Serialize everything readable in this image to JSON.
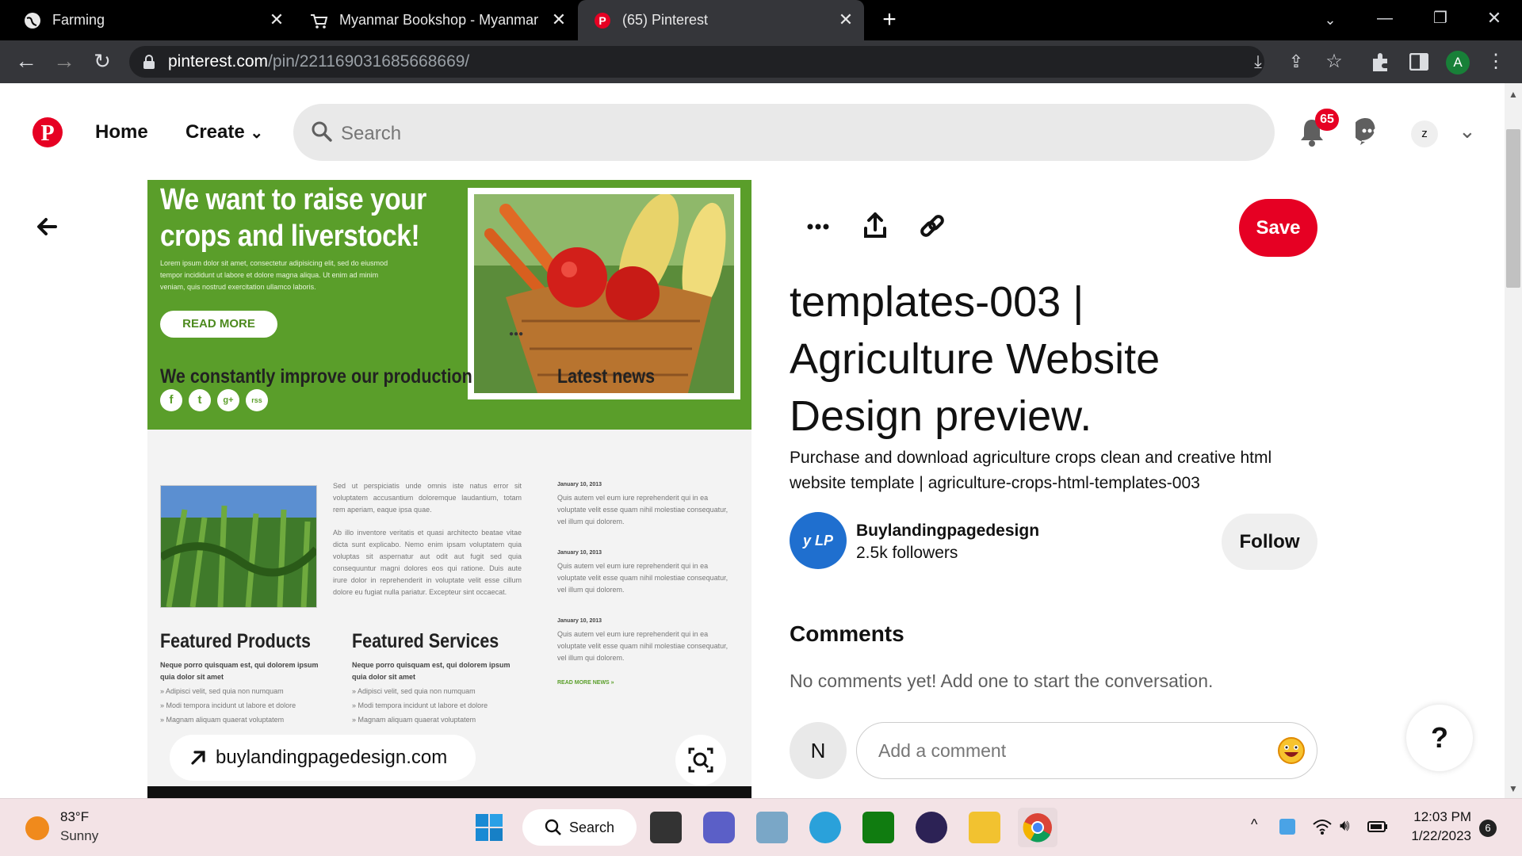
{
  "browser": {
    "tabs": [
      {
        "title": "Farming",
        "icon": "globe-icon"
      },
      {
        "title": "Myanmar Bookshop - Myanmar",
        "icon": "cart-icon"
      },
      {
        "title": "(65) Pinterest",
        "icon": "pinterest-icon"
      }
    ],
    "url_domain": "pinterest.com",
    "url_path": "/pin/221169031685668669/",
    "profile_initial": "A"
  },
  "header": {
    "nav_home": "Home",
    "nav_create": "Create",
    "search_placeholder": "Search",
    "notification_count": "65",
    "user_initial": "z"
  },
  "pin_image": {
    "hero_line1": "We want to raise your",
    "hero_line2": "crops and liverstock!",
    "hero_lorem_1": "Lorem ipsum dolor sit amet, consectetur adipisicing elit, sed do eiusmod",
    "hero_lorem_2": "tempor incididunt ut labore et dolore magna aliqua. Ut enim ad minim",
    "hero_lorem_3": "veniam, quis nostrud exercitation ullamco laboris.",
    "read_more": "READ MORE",
    "social": [
      "f",
      "t",
      "g+",
      "rss"
    ],
    "section1_title": "We constantly improve our production",
    "section1_p1": "Sed ut perspiciatis unde omnis iste natus error sit voluptatem accusantium doloremque laudantium, totam rem aperiam, eaque ipsa quae.",
    "section1_p2": "Ab illo inventore veritatis et quasi architecto beatae vitae dicta sunt explicabo. Nemo enim ipsam voluptatem quia voluptas sit aspernatur aut odit aut fugit sed quia consequuntur magni dolores eos qui ratione. Duis aute irure dolor in reprehenderit in voluptate velit esse cillum dolore eu fugiat nulla pariatur. Excepteur sint occaecat.",
    "news_title": "Latest news",
    "news_items": [
      {
        "date": "January 10, 2013",
        "text": "Quis autem vel eum iure reprehenderit qui in ea voluptate velit esse quam nihil molestiae consequatur, vel illum qui dolorem."
      },
      {
        "date": "January 10, 2013",
        "text": "Quis autem vel eum iure reprehenderit qui in ea voluptate velit esse quam nihil molestiae consequatur, vel illum qui dolorem."
      },
      {
        "date": "January 10, 2013",
        "text": "Quis autem vel eum iure reprehenderit qui in ea voluptate velit esse quam nihil molestiae consequatur, vel illum qui dolorem."
      }
    ],
    "read_more_news": "READ MORE NEWS »",
    "products_title": "Featured Products",
    "services_title": "Featured Services",
    "feature_bold": "Neque porro quisquam est, qui dolorem ipsum quia dolor sit amet",
    "feature_list": [
      "» Adipisci velit, sed quia non numquam",
      "» Modi tempora incidunt ut labore et dolore",
      "» Magnam aliquam quaerat voluptatem"
    ],
    "link_text": "buylandingpagedesign.com"
  },
  "pin": {
    "save_label": "Save",
    "title": "templates-003 | Agriculture Website Design preview.",
    "description": "Purchase and download agriculture crops clean and creative html website template | agriculture-crops-html-templates-003",
    "creator_avatar_text": "y LP Des",
    "creator_name": "Buylandingpagedesign",
    "followers": "2.5k followers",
    "follow_label": "Follow",
    "comments_heading": "Comments",
    "no_comments": "No comments yet! Add one to start the conversation.",
    "commenter_initial": "N",
    "comment_placeholder": "Add a comment",
    "help_label": "?"
  },
  "taskbar": {
    "temperature": "83°F",
    "condition": "Sunny",
    "search_label": "Search",
    "time": "12:03 PM",
    "date": "1/22/2023",
    "notification_count": "6"
  },
  "colors": {
    "pinterest_red": "#e60023",
    "hero_green": "#5a9e2a"
  }
}
